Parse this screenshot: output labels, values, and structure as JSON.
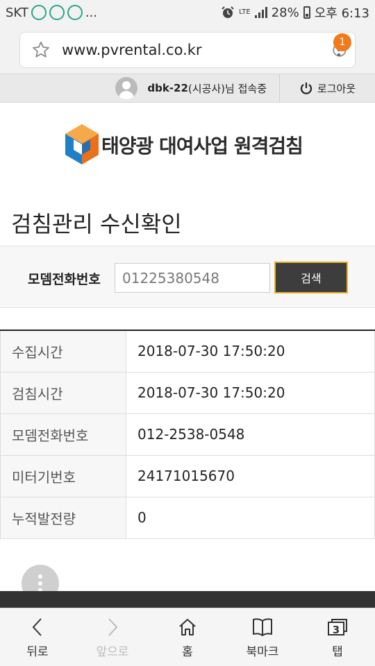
{
  "status_bar": {
    "carrier": "SKT",
    "more": "...",
    "network": "LTE",
    "battery": "28%",
    "time": "오후 6:13"
  },
  "browser": {
    "url": "www.pvrental.co.kr",
    "badge_count": "1"
  },
  "user_bar": {
    "user_id": "dbk-22",
    "user_suffix": "(시공사)님 접속중",
    "logout_label": "로그아웃"
  },
  "logo": {
    "text": "태양광 대여사업 원격검침"
  },
  "page": {
    "title": "검침관리 수신확인"
  },
  "search": {
    "label": "모뎀전화번호",
    "value": "01225380548",
    "button_label": "검색"
  },
  "details": [
    {
      "key": "수집시간",
      "value": "2018-07-30 17:50:20"
    },
    {
      "key": "검침시간",
      "value": "2018-07-30 17:50:20"
    },
    {
      "key": "모뎀전화번호",
      "value": "012-2538-0548"
    },
    {
      "key": "미터기번호",
      "value": "24171015670"
    },
    {
      "key": "누적발전량",
      "value": "0"
    }
  ],
  "bottom_nav": {
    "back": "뒤로",
    "forward": "앞으로",
    "home": "홈",
    "bookmarks": "북마크",
    "tabs": "탭",
    "tab_count": "3"
  },
  "colors": {
    "badge": "#f07a1c",
    "search_button_bg": "#3d3d3d",
    "search_button_border": "#e6b32a",
    "logo_orange": "#f08a1d",
    "logo_blue": "#1f7fc8"
  }
}
